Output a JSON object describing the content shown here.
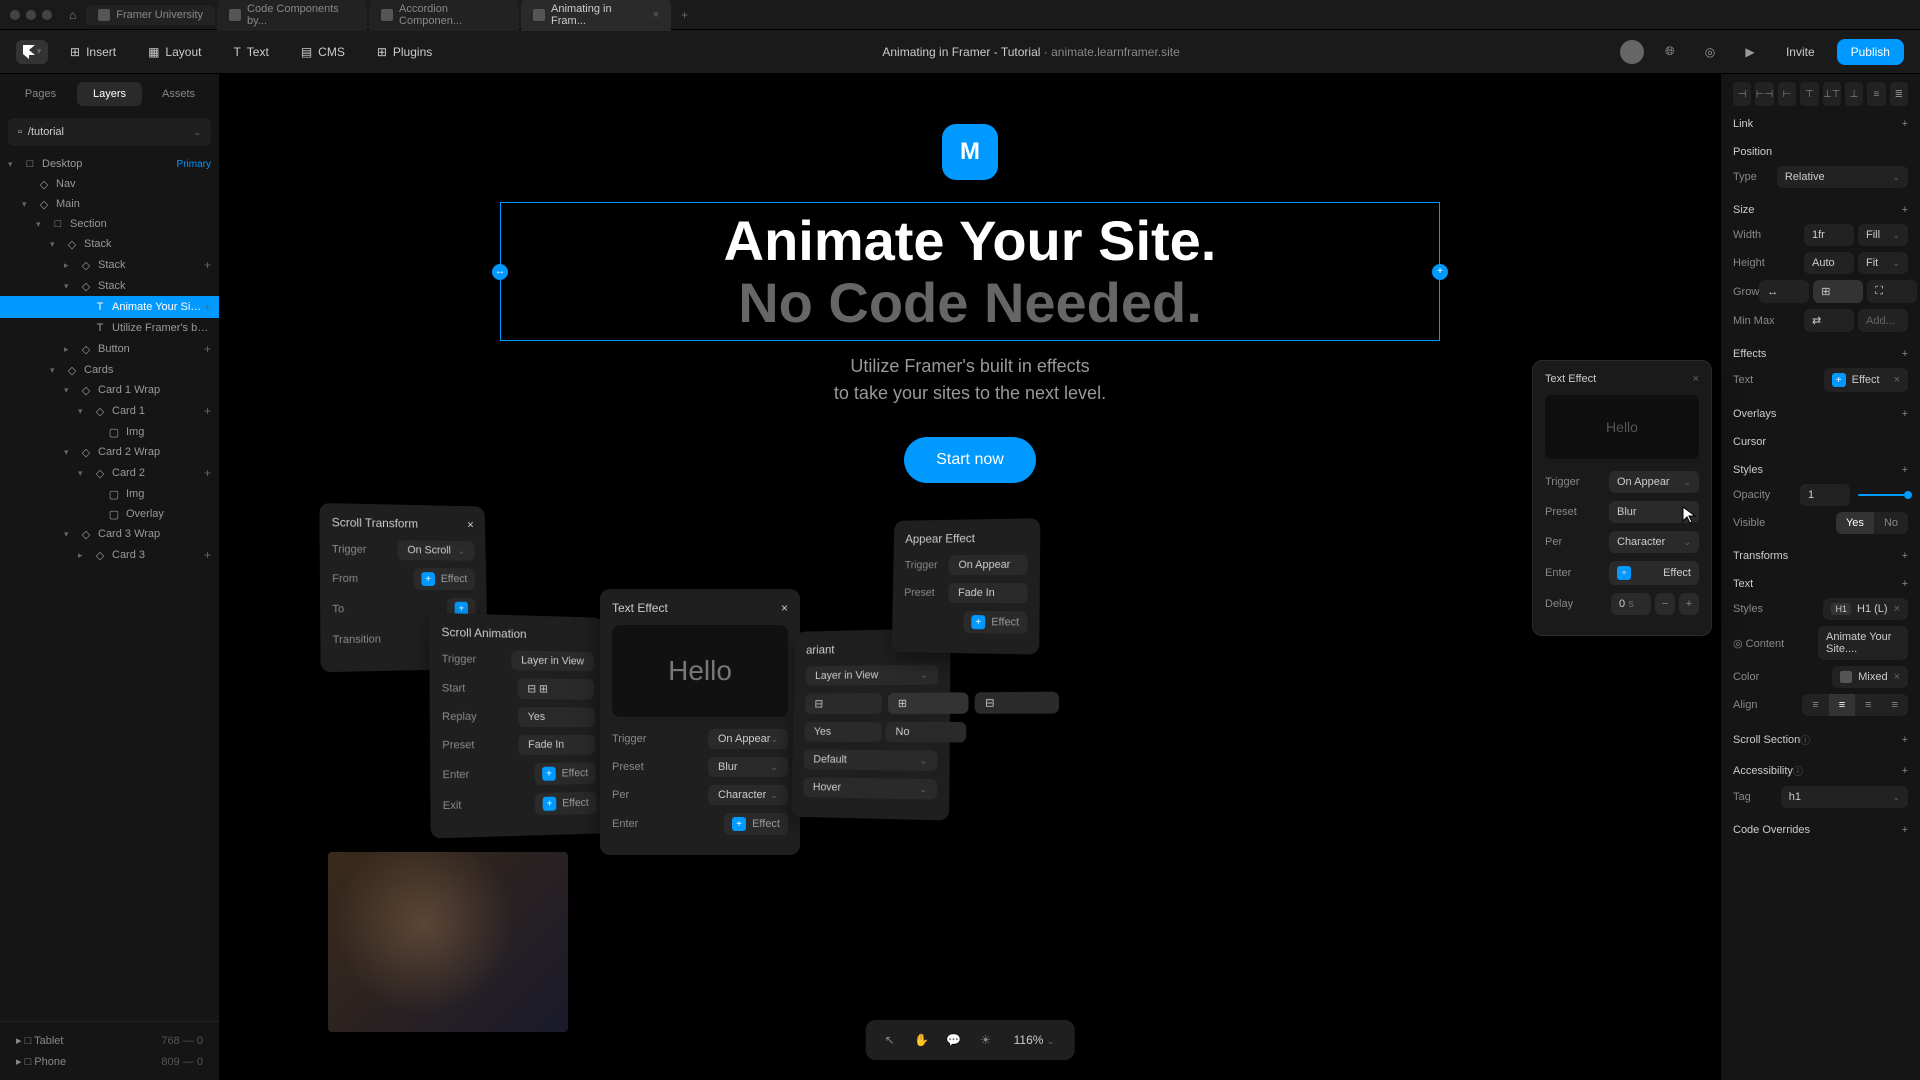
{
  "chrome": {
    "tabs": [
      {
        "label": "Framer University",
        "active": false
      },
      {
        "label": "Code Components by...",
        "active": false
      },
      {
        "label": "Accordion Componen...",
        "active": false
      },
      {
        "label": "Animating in Fram...",
        "active": true
      }
    ]
  },
  "toolbar": {
    "insert": "Insert",
    "layout": "Layout",
    "text": "Text",
    "cms": "CMS",
    "plugins": "Plugins",
    "title": "Animating in Framer - Tutorial",
    "domain": "animate.learnframer.site",
    "invite": "Invite",
    "publish": "Publish"
  },
  "left": {
    "tabs": [
      "Pages",
      "Layers",
      "Assets"
    ],
    "active_tab": "Layers",
    "breadcrumb": "/tutorial",
    "layers": [
      {
        "indent": 0,
        "label": "Desktop",
        "badge": "Primary",
        "chev": "▾",
        "icon": "□"
      },
      {
        "indent": 1,
        "label": "Nav",
        "icon": "◇"
      },
      {
        "indent": 1,
        "label": "Main",
        "chev": "▾",
        "icon": "◇"
      },
      {
        "indent": 2,
        "label": "Section",
        "chev": "▾",
        "icon": "□"
      },
      {
        "indent": 3,
        "label": "Stack",
        "chev": "▾",
        "icon": "◇"
      },
      {
        "indent": 4,
        "label": "Stack",
        "chev": "▸",
        "add": "+",
        "icon": "◇"
      },
      {
        "indent": 4,
        "label": "Stack",
        "chev": "▾",
        "icon": "◇"
      },
      {
        "indent": 5,
        "label": "Animate Your Site...",
        "selected": true,
        "add": "+",
        "icon": "T"
      },
      {
        "indent": 5,
        "label": "Utilize Framer's buil...",
        "icon": "T"
      },
      {
        "indent": 4,
        "label": "Button",
        "chev": "▸",
        "add": "+",
        "icon": "◇"
      },
      {
        "indent": 3,
        "label": "Cards",
        "chev": "▾",
        "icon": "◇"
      },
      {
        "indent": 4,
        "label": "Card 1 Wrap",
        "chev": "▾",
        "icon": "◇"
      },
      {
        "indent": 5,
        "label": "Card 1",
        "chev": "▾",
        "add": "+",
        "icon": "◇"
      },
      {
        "indent": 6,
        "label": "Img",
        "icon": "▢"
      },
      {
        "indent": 4,
        "label": "Card 2 Wrap",
        "chev": "▾",
        "icon": "◇"
      },
      {
        "indent": 5,
        "label": "Card 2",
        "chev": "▾",
        "add": "+",
        "icon": "◇"
      },
      {
        "indent": 6,
        "label": "Img",
        "icon": "▢"
      },
      {
        "indent": 6,
        "label": "Overlay",
        "icon": "▢"
      },
      {
        "indent": 4,
        "label": "Card 3 Wrap",
        "chev": "▾",
        "icon": "◇"
      },
      {
        "indent": 5,
        "label": "Card 3",
        "chev": "▸",
        "add": "+",
        "icon": "◇"
      }
    ],
    "breakpoints": [
      {
        "label": "Tablet",
        "val": "768 — 0"
      },
      {
        "label": "Phone",
        "val": "809 — 0"
      }
    ]
  },
  "canvas": {
    "logo": "M",
    "title_line1": "Animate Your Site.",
    "title_line2": "No Code Needed.",
    "subtitle_line1": "Utilize Framer's built in effects",
    "subtitle_line2": "to take your sites to the next level.",
    "cta": "Start now",
    "zoom": "116%",
    "float_scroll": {
      "title": "Scroll Transform",
      "rows": [
        {
          "label": "Trigger",
          "val": "On Scroll"
        },
        {
          "label": "From"
        },
        {
          "label": "To"
        },
        {
          "label": "Transition"
        }
      ],
      "effect": "Effect"
    },
    "float_scroll_anim": {
      "title": "Scroll Animation",
      "rows": [
        {
          "label": "Trigger",
          "val": "Layer in View"
        },
        {
          "label": "Start"
        },
        {
          "label": "Replay",
          "val": "Yes"
        },
        {
          "label": "Preset",
          "val": "Fade In"
        },
        {
          "label": "Enter",
          "effect": "Effect"
        },
        {
          "label": "Exit",
          "effect": "Effect"
        }
      ]
    },
    "float_text": {
      "title": "Text Effect",
      "preview": "Hello",
      "rows": [
        {
          "label": "Trigger",
          "val": "On Appear"
        },
        {
          "label": "Preset",
          "val": "Blur"
        },
        {
          "label": "Per",
          "val": "Character"
        },
        {
          "label": "Enter",
          "effect": "Effect"
        }
      ]
    },
    "float_appear": {
      "title": "Appear Effect",
      "rows": [
        {
          "label": "Trigger",
          "val": "On Appear"
        },
        {
          "label": "Preset",
          "val": "Fade In"
        }
      ],
      "effect": "Effect"
    },
    "float_variant": {
      "title": "ariant",
      "rows": [
        {
          "label": "",
          "val": "Layer in View"
        },
        {
          "label": "",
          "val_yes": "Yes",
          "val_no": "No"
        },
        {
          "label": "",
          "val": "Default"
        },
        {
          "label": "",
          "val": "Hover"
        }
      ]
    }
  },
  "text_effect": {
    "title": "Text Effect",
    "preview": "Hello",
    "trigger_label": "Trigger",
    "trigger_val": "On Appear",
    "preset_label": "Preset",
    "preset_val": "Blur",
    "per_label": "Per",
    "per_val": "Character",
    "enter_label": "Enter",
    "enter_val": "Effect",
    "delay_label": "Delay",
    "delay_val": "0",
    "delay_unit": "s"
  },
  "right": {
    "link": "Link",
    "position": {
      "header": "Position",
      "type_label": "Type",
      "type_val": "Relative"
    },
    "size": {
      "header": "Size",
      "width_label": "Width",
      "width_val": "1fr",
      "width_mode": "Fill",
      "height_label": "Height",
      "height_val": "Auto",
      "height_mode": "Fit",
      "grow_label": "Grow",
      "minmax_label": "Min Max",
      "minmax_val": "Add..."
    },
    "effects": {
      "header": "Effects",
      "text_label": "Text",
      "effect_val": "Effect"
    },
    "overlays": "Overlays",
    "cursor": "Cursor",
    "styles": {
      "header": "Styles",
      "opacity_label": "Opacity",
      "opacity_val": "1",
      "visible_label": "Visible",
      "visible_yes": "Yes",
      "visible_no": "No"
    },
    "transforms": "Transforms",
    "text": {
      "header": "Text",
      "styles_label": "Styles",
      "styles_val": "H1 (L)",
      "styles_badge": "H1",
      "content_label": "Content",
      "content_val": "Animate Your Site....",
      "color_label": "Color",
      "color_val": "Mixed",
      "align_label": "Align"
    },
    "scroll": "Scroll Section",
    "accessibility": {
      "header": "Accessibility",
      "tag_label": "Tag",
      "tag_val": "h1"
    },
    "overrides": "Code Overrides"
  }
}
